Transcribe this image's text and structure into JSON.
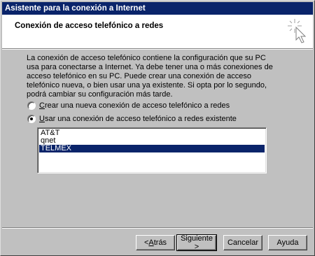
{
  "window": {
    "title": "Asistente para la conexión a Internet"
  },
  "header": {
    "title": "Conexión de acceso telefónico a redes",
    "icon": "wizard-wand-icon"
  },
  "description": "La conexión de acceso telefónico contiene la configuración que su PC usa para conectarse a Internet. Ya debe tener una o más conexiones de acceso telefónico en su PC. Puede crear una conexión de acceso telefónico nueva, o bien usar una ya existente. Si opta por lo segundo, podrá cambiar su configuración más tarde.",
  "options": {
    "create_new": {
      "accel": "C",
      "rest": "rear una nueva conexión de acceso telefónico a redes",
      "selected": false
    },
    "use_existing": {
      "accel": "U",
      "rest": "sar una conexión de acceso telefónico a redes existente",
      "selected": true
    }
  },
  "connections": {
    "items": [
      "AT&T",
      "qnet",
      "TELMEX"
    ],
    "selected": "TELMEX"
  },
  "buttons": {
    "back_prefix": "< ",
    "back_accel": "A",
    "back_rest": "trás",
    "next": "Siguiente >",
    "cancel": "Cancelar",
    "help": "Ayuda"
  }
}
